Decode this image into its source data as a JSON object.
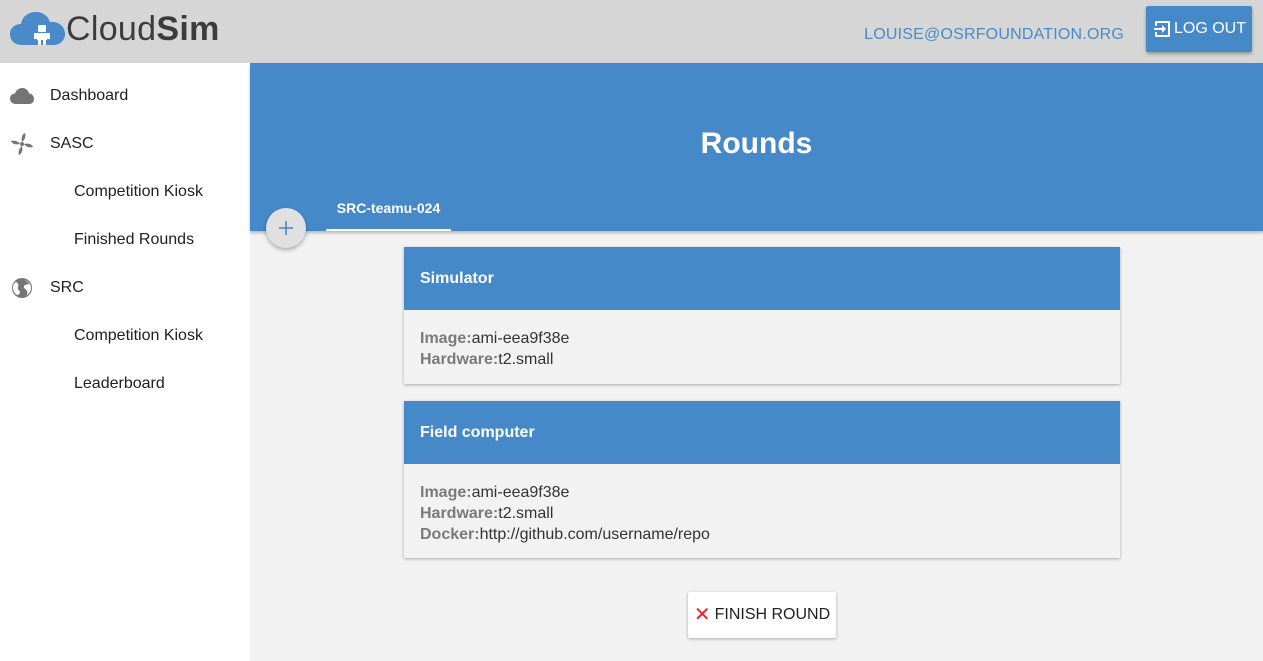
{
  "app": {
    "logo_text_light": "Cloud",
    "logo_text_bold": "Sim",
    "brand_color": "#4589c8"
  },
  "header": {
    "user_email": "LOUISE@OSRFOUNDATION.ORG",
    "logout_label": "LOG OUT"
  },
  "sidebar": {
    "items": [
      {
        "label": "Dashboard",
        "icon": "cloud-icon"
      },
      {
        "label": "SASC",
        "icon": "pinwheel-icon"
      },
      {
        "label": "Competition Kiosk"
      },
      {
        "label": "Finished Rounds"
      },
      {
        "label": "SRC",
        "icon": "globe-icon"
      },
      {
        "label": "Competition Kiosk"
      },
      {
        "label": "Leaderboard"
      }
    ]
  },
  "main": {
    "title": "Rounds",
    "tabs": [
      {
        "label": "SRC-teamu-024"
      }
    ],
    "cards": [
      {
        "title": "Simulator",
        "rows": [
          {
            "key": "Image:",
            "value": "ami-eea9f38e"
          },
          {
            "key": "Hardware:",
            "value": "t2.small"
          }
        ]
      },
      {
        "title": "Field computer",
        "rows": [
          {
            "key": "Image:",
            "value": "ami-eea9f38e"
          },
          {
            "key": "Hardware:",
            "value": "t2.small"
          },
          {
            "key": "Docker:",
            "value": "http://github.com/username/repo"
          }
        ]
      }
    ],
    "finish_label": "FINISH ROUND"
  }
}
